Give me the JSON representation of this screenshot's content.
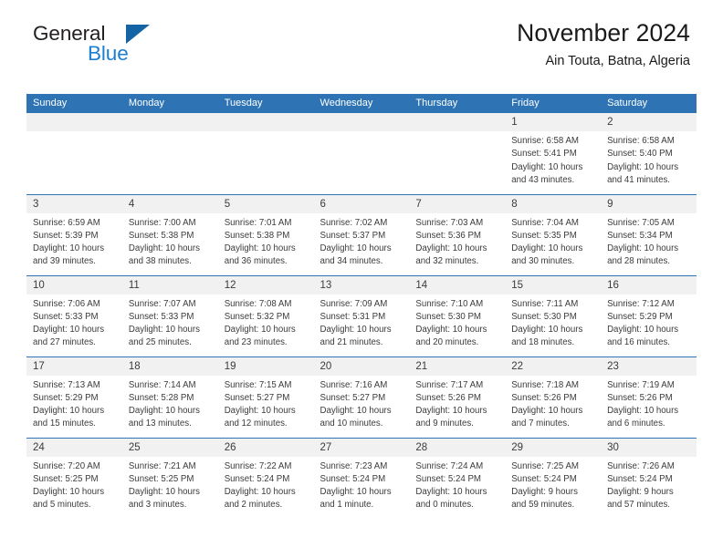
{
  "brand": {
    "name_top": "General",
    "name_bottom": "Blue",
    "flag_color": "#1464a5",
    "blue_color": "#1c7fd0"
  },
  "header": {
    "title": "November 2024",
    "subtitle": "Ain Touta, Batna, Algeria",
    "header_bg": "#2e74b5",
    "daynum_bg": "#f1f1f1"
  },
  "weekday_headers": [
    "Sunday",
    "Monday",
    "Tuesday",
    "Wednesday",
    "Thursday",
    "Friday",
    "Saturday"
  ],
  "calendar": {
    "month": "November",
    "year": "2024",
    "weeks": [
      [
        {
          "day": "",
          "empty": true
        },
        {
          "day": "",
          "empty": true
        },
        {
          "day": "",
          "empty": true
        },
        {
          "day": "",
          "empty": true
        },
        {
          "day": "",
          "empty": true
        },
        {
          "day": "1",
          "sunrise": "Sunrise: 6:58 AM",
          "sunset": "Sunset: 5:41 PM",
          "daylight1": "Daylight: 10 hours",
          "daylight2": "and 43 minutes."
        },
        {
          "day": "2",
          "sunrise": "Sunrise: 6:58 AM",
          "sunset": "Sunset: 5:40 PM",
          "daylight1": "Daylight: 10 hours",
          "daylight2": "and 41 minutes."
        }
      ],
      [
        {
          "day": "3",
          "sunrise": "Sunrise: 6:59 AM",
          "sunset": "Sunset: 5:39 PM",
          "daylight1": "Daylight: 10 hours",
          "daylight2": "and 39 minutes."
        },
        {
          "day": "4",
          "sunrise": "Sunrise: 7:00 AM",
          "sunset": "Sunset: 5:38 PM",
          "daylight1": "Daylight: 10 hours",
          "daylight2": "and 38 minutes."
        },
        {
          "day": "5",
          "sunrise": "Sunrise: 7:01 AM",
          "sunset": "Sunset: 5:38 PM",
          "daylight1": "Daylight: 10 hours",
          "daylight2": "and 36 minutes."
        },
        {
          "day": "6",
          "sunrise": "Sunrise: 7:02 AM",
          "sunset": "Sunset: 5:37 PM",
          "daylight1": "Daylight: 10 hours",
          "daylight2": "and 34 minutes."
        },
        {
          "day": "7",
          "sunrise": "Sunrise: 7:03 AM",
          "sunset": "Sunset: 5:36 PM",
          "daylight1": "Daylight: 10 hours",
          "daylight2": "and 32 minutes."
        },
        {
          "day": "8",
          "sunrise": "Sunrise: 7:04 AM",
          "sunset": "Sunset: 5:35 PM",
          "daylight1": "Daylight: 10 hours",
          "daylight2": "and 30 minutes."
        },
        {
          "day": "9",
          "sunrise": "Sunrise: 7:05 AM",
          "sunset": "Sunset: 5:34 PM",
          "daylight1": "Daylight: 10 hours",
          "daylight2": "and 28 minutes."
        }
      ],
      [
        {
          "day": "10",
          "sunrise": "Sunrise: 7:06 AM",
          "sunset": "Sunset: 5:33 PM",
          "daylight1": "Daylight: 10 hours",
          "daylight2": "and 27 minutes."
        },
        {
          "day": "11",
          "sunrise": "Sunrise: 7:07 AM",
          "sunset": "Sunset: 5:33 PM",
          "daylight1": "Daylight: 10 hours",
          "daylight2": "and 25 minutes."
        },
        {
          "day": "12",
          "sunrise": "Sunrise: 7:08 AM",
          "sunset": "Sunset: 5:32 PM",
          "daylight1": "Daylight: 10 hours",
          "daylight2": "and 23 minutes."
        },
        {
          "day": "13",
          "sunrise": "Sunrise: 7:09 AM",
          "sunset": "Sunset: 5:31 PM",
          "daylight1": "Daylight: 10 hours",
          "daylight2": "and 21 minutes."
        },
        {
          "day": "14",
          "sunrise": "Sunrise: 7:10 AM",
          "sunset": "Sunset: 5:30 PM",
          "daylight1": "Daylight: 10 hours",
          "daylight2": "and 20 minutes."
        },
        {
          "day": "15",
          "sunrise": "Sunrise: 7:11 AM",
          "sunset": "Sunset: 5:30 PM",
          "daylight1": "Daylight: 10 hours",
          "daylight2": "and 18 minutes."
        },
        {
          "day": "16",
          "sunrise": "Sunrise: 7:12 AM",
          "sunset": "Sunset: 5:29 PM",
          "daylight1": "Daylight: 10 hours",
          "daylight2": "and 16 minutes."
        }
      ],
      [
        {
          "day": "17",
          "sunrise": "Sunrise: 7:13 AM",
          "sunset": "Sunset: 5:29 PM",
          "daylight1": "Daylight: 10 hours",
          "daylight2": "and 15 minutes."
        },
        {
          "day": "18",
          "sunrise": "Sunrise: 7:14 AM",
          "sunset": "Sunset: 5:28 PM",
          "daylight1": "Daylight: 10 hours",
          "daylight2": "and 13 minutes."
        },
        {
          "day": "19",
          "sunrise": "Sunrise: 7:15 AM",
          "sunset": "Sunset: 5:27 PM",
          "daylight1": "Daylight: 10 hours",
          "daylight2": "and 12 minutes."
        },
        {
          "day": "20",
          "sunrise": "Sunrise: 7:16 AM",
          "sunset": "Sunset: 5:27 PM",
          "daylight1": "Daylight: 10 hours",
          "daylight2": "and 10 minutes."
        },
        {
          "day": "21",
          "sunrise": "Sunrise: 7:17 AM",
          "sunset": "Sunset: 5:26 PM",
          "daylight1": "Daylight: 10 hours",
          "daylight2": "and 9 minutes."
        },
        {
          "day": "22",
          "sunrise": "Sunrise: 7:18 AM",
          "sunset": "Sunset: 5:26 PM",
          "daylight1": "Daylight: 10 hours",
          "daylight2": "and 7 minutes."
        },
        {
          "day": "23",
          "sunrise": "Sunrise: 7:19 AM",
          "sunset": "Sunset: 5:26 PM",
          "daylight1": "Daylight: 10 hours",
          "daylight2": "and 6 minutes."
        }
      ],
      [
        {
          "day": "24",
          "sunrise": "Sunrise: 7:20 AM",
          "sunset": "Sunset: 5:25 PM",
          "daylight1": "Daylight: 10 hours",
          "daylight2": "and 5 minutes."
        },
        {
          "day": "25",
          "sunrise": "Sunrise: 7:21 AM",
          "sunset": "Sunset: 5:25 PM",
          "daylight1": "Daylight: 10 hours",
          "daylight2": "and 3 minutes."
        },
        {
          "day": "26",
          "sunrise": "Sunrise: 7:22 AM",
          "sunset": "Sunset: 5:24 PM",
          "daylight1": "Daylight: 10 hours",
          "daylight2": "and 2 minutes."
        },
        {
          "day": "27",
          "sunrise": "Sunrise: 7:23 AM",
          "sunset": "Sunset: 5:24 PM",
          "daylight1": "Daylight: 10 hours",
          "daylight2": "and 1 minute."
        },
        {
          "day": "28",
          "sunrise": "Sunrise: 7:24 AM",
          "sunset": "Sunset: 5:24 PM",
          "daylight1": "Daylight: 10 hours",
          "daylight2": "and 0 minutes."
        },
        {
          "day": "29",
          "sunrise": "Sunrise: 7:25 AM",
          "sunset": "Sunset: 5:24 PM",
          "daylight1": "Daylight: 9 hours",
          "daylight2": "and 59 minutes."
        },
        {
          "day": "30",
          "sunrise": "Sunrise: 7:26 AM",
          "sunset": "Sunset: 5:24 PM",
          "daylight1": "Daylight: 9 hours",
          "daylight2": "and 57 minutes."
        }
      ]
    ]
  }
}
